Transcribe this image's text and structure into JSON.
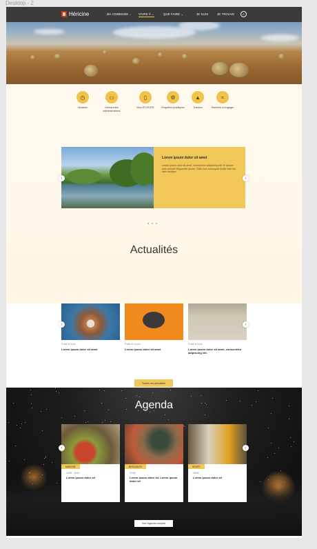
{
  "frame": {
    "label": "Desktop - 2"
  },
  "header": {
    "logo_text": "Héricine",
    "nav": [
      {
        "label": "MA COMMUNE",
        "has_chevron": true,
        "active": false
      },
      {
        "label": "VIVRE À",
        "has_chevron": true,
        "active": true
      },
      {
        "label": "QUE FAIRE",
        "has_chevron": true,
        "active": false
      },
      {
        "label": "JE SUIS",
        "has_chevron": false,
        "active": false
      },
      {
        "label": "JE TROUVE",
        "has_chevron": false,
        "active": false
      }
    ],
    "search_icon": "search-icon"
  },
  "quick_links": [
    {
      "label": "Horaires",
      "icon": "clock-icon"
    },
    {
      "label": "Démarches administratives",
      "icon": "monitor-icon"
    },
    {
      "label": "Mon ÉCOLIER",
      "icon": "book-icon"
    },
    {
      "label": "Enquêtes publiques",
      "icon": "gears-icon"
    },
    {
      "label": "Travaux",
      "icon": "cone-icon"
    },
    {
      "label": "Marchés à engager",
      "icon": "handshake-icon"
    }
  ],
  "slider": {
    "title": "Lorem ipsum dolor sit amet",
    "text": "Lorem ipsum dolor sit amet, consectetur adipiscing elit. Et aliquet ante semper fréquenter ipsum. Odio mus consequat mollis nisin leo dant tristique.",
    "dots": 3,
    "active_dot": 0
  },
  "news": {
    "title": "Actualités",
    "items": [
      {
        "date": "Publié le 8 juin",
        "title": "Lorem ipsum dolor sit amet"
      },
      {
        "date": "Publié le 10 juin",
        "title": "Lorem ipsum dolor sit amet"
      },
      {
        "date": "Publié le 8 juin",
        "title": "Lorem ipsum dolor sit amet, consectetur adipiscing elit."
      }
    ],
    "button_label": "Toutes les actualités",
    "dots": 2,
    "active_dot": 0
  },
  "agenda": {
    "title": "Agenda",
    "items": [
      {
        "tag": "MARCHÉ",
        "date": "11/06 - 11/07",
        "title": "Lorem ipsum dolor sit"
      },
      {
        "tag": "BROCANTE",
        "date": "27/06",
        "title": "Lorem ipsum dolor sit, Lorem ipsum dolor sit"
      },
      {
        "tag": "SPORT",
        "date": "28/06",
        "title": "Lorem ipsum dolor sit"
      }
    ],
    "button_label": "Voir l'agenda complet"
  },
  "colors": {
    "accent": "#f2c75a",
    "nav_bg": "#3b3b3b",
    "cream": "#fff8ec",
    "dark": "#111111"
  }
}
